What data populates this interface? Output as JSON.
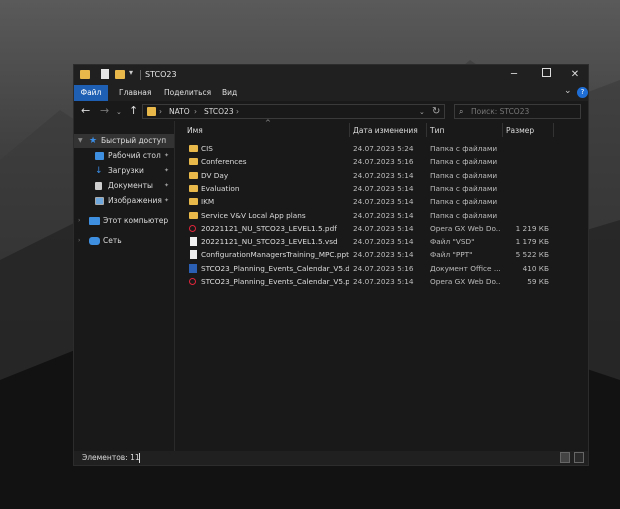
{
  "window": {
    "title": "STCO23",
    "controls": {
      "minimize": "─",
      "maximize": "",
      "close": "✕"
    }
  },
  "quick_access_toolbar": {
    "dropdown": "▾"
  },
  "ribbon": {
    "tabs": [
      "Файл",
      "Главная",
      "Поделиться",
      "Вид"
    ],
    "expand": "⌄",
    "help": "?"
  },
  "nav": {
    "back": "←",
    "forward": "→",
    "recent": "⌄",
    "up": "↑"
  },
  "address": {
    "crumbs": [
      "NATO",
      "STCO23"
    ],
    "separator": "›",
    "dropdown": "⌄",
    "refresh": "↻"
  },
  "search": {
    "placeholder": "Поиск: STCO23",
    "icon": "⌕"
  },
  "sidebar": {
    "items": [
      {
        "label": "Быстрый доступ",
        "icon": "star-icon",
        "pinned": false
      },
      {
        "label": "Рабочий стол",
        "icon": "desktop-icon",
        "pinned": true
      },
      {
        "label": "Загрузки",
        "icon": "download-icon",
        "pinned": true
      },
      {
        "label": "Документы",
        "icon": "documents-icon",
        "pinned": true
      },
      {
        "label": "Изображения",
        "icon": "pictures-icon",
        "pinned": true
      },
      {
        "label": "Этот компьютер",
        "icon": "computer-icon",
        "pinned": false
      },
      {
        "label": "Сеть",
        "icon": "network-icon",
        "pinned": false
      }
    ],
    "pin_glyph": "📌"
  },
  "columns": {
    "name": "Имя",
    "date": "Дата изменения",
    "type": "Тип",
    "size": "Размер",
    "sort_indicator": "^"
  },
  "files": [
    {
      "name": "CIS",
      "date": "24.07.2023 5:24",
      "type": "Папка с файлами",
      "size": "",
      "icon": "folder"
    },
    {
      "name": "Conferences",
      "date": "24.07.2023 5:16",
      "type": "Папка с файлами",
      "size": "",
      "icon": "folder"
    },
    {
      "name": "DV Day",
      "date": "24.07.2023 5:14",
      "type": "Папка с файлами",
      "size": "",
      "icon": "folder"
    },
    {
      "name": "Evaluation",
      "date": "24.07.2023 5:14",
      "type": "Папка с файлами",
      "size": "",
      "icon": "folder"
    },
    {
      "name": "IKM",
      "date": "24.07.2023 5:14",
      "type": "Папка с файлами",
      "size": "",
      "icon": "folder"
    },
    {
      "name": "Service V&V Local App plans",
      "date": "24.07.2023 5:14",
      "type": "Папка с файлами",
      "size": "",
      "icon": "folder"
    },
    {
      "name": "20221121_NU_STCO23_LEVEL1.5.pdf",
      "date": "24.07.2023 5:14",
      "type": "Opera GX Web Do...",
      "size": "1 219 КБ",
      "icon": "opera"
    },
    {
      "name": "20221121_NU_STCO23_LEVEL1.5.vsd",
      "date": "24.07.2023 5:14",
      "type": "Файл \"VSD\"",
      "size": "1 179 КБ",
      "icon": "doc"
    },
    {
      "name": "ConfigurationManagersTraining_MPC.ppt",
      "date": "24.07.2023 5:14",
      "type": "Файл \"PPT\"",
      "size": "5 522 КБ",
      "icon": "doc"
    },
    {
      "name": "STCO23_Planning_Events_Calendar_V5.d...",
      "date": "24.07.2023 5:16",
      "type": "Документ Office ...",
      "size": "410 КБ",
      "icon": "word"
    },
    {
      "name": "STCO23_Planning_Events_Calendar_V5.pdf",
      "date": "24.07.2023 5:14",
      "type": "Opera GX Web Do...",
      "size": "59 КБ",
      "icon": "opera"
    }
  ],
  "status": {
    "items_count": "Элементов: 11"
  },
  "colors": {
    "accent": "#1e5fb3",
    "folder": "#e8b84a",
    "opera": "#e0253a",
    "background": "#191919"
  }
}
